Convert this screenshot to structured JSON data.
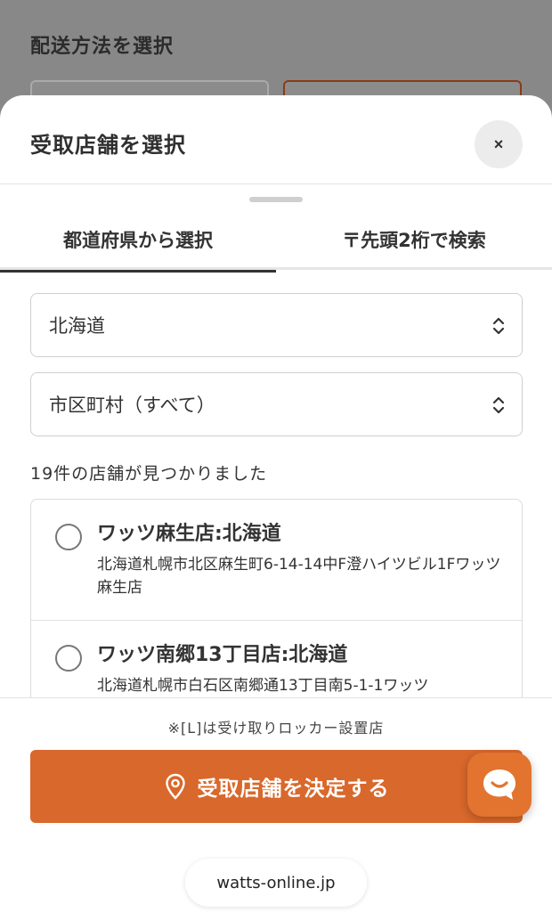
{
  "background": {
    "title": "配送方法を選択"
  },
  "modal": {
    "title": "受取店舗を選択",
    "close_label": "×",
    "tabs": [
      {
        "label": "都道府県から選択",
        "active": true
      },
      {
        "label": "〒先頭2桁で検索",
        "active": false
      }
    ],
    "prefecture_select": {
      "value": "北海道"
    },
    "city_select": {
      "value": "市区町村（すべて）"
    },
    "result_count": "19件の店舗が見つかりました",
    "stores": [
      {
        "name": "ワッツ麻生店:北海道",
        "address": "北海道札幌市北区麻生町6-14-14中F澄ハイツビル1Fワッツ麻生店",
        "selected": false
      },
      {
        "name": "ワッツ南郷13丁目店:北海道",
        "address": "北海道札幌市白石区南郷通13丁目南5-1-1ワッツ",
        "selected": false
      }
    ],
    "locker_note": "※[L]は受け取りロッカー設置店",
    "decide_button": "受取店舗を決定する",
    "icons": {
      "decide": "location-pin-icon",
      "chat": "chat-bubble-icon",
      "select": "chevron-up-down-icon"
    },
    "colors": {
      "accent": "#d9682c",
      "chat": "#e2742f"
    }
  },
  "browser": {
    "url": "watts-online.jp"
  }
}
